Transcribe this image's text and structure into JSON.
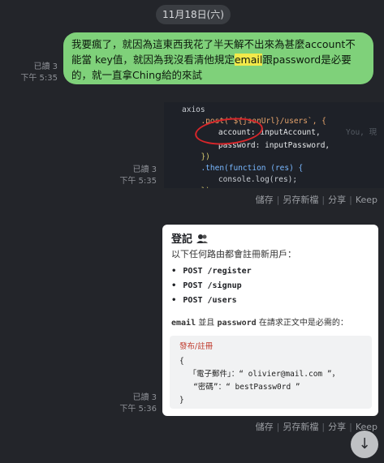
{
  "date_pill": "11月18日(六)",
  "messages": {
    "m1": {
      "text_before": "我要瘋了，就因為這東西我花了半天解不出來為甚麼account不能當 key值，就因為我沒看清他規定",
      "highlight": "email",
      "text_after": "跟password是必要的，就一直拿Ching給的來試",
      "read": "已讀 3",
      "time": "下午 5:35"
    },
    "m2": {
      "read": "已讀 3",
      "time": "下午 5:35",
      "code_lines": [
        "axios",
        "  .post(`${jsonUrl}/users`, {",
        "    account: inputAccount,",
        "    password: inputPassword,",
        "  })",
        "  .then(function (res) {",
        "    console.log(res);",
        "  })"
      ],
      "ghost": "You, 現"
    },
    "m3": {
      "read": "已讀 3",
      "time": "下午 5:36",
      "title": "登記",
      "intro": "以下任何路由都會註冊新用戶：",
      "routes": [
        "POST /register",
        "POST /signup",
        "POST /users"
      ],
      "note_email": "email",
      "note_mid": " 並且 ",
      "note_password": "password",
      "note_end": " 在請求正文中是必需的：",
      "code_label": "發布/註冊",
      "code_open": "{",
      "code_line1": "  「電子郵件」：“ olivier@mail.com ”，",
      "code_line2": "   “密碼”：“ bestPassw0rd ”",
      "code_close": "}"
    }
  },
  "actions": {
    "save": "儲存",
    "save_as": "另存新檔",
    "share": "分享",
    "keep": "Keep"
  },
  "colors": {
    "background": "#23252a",
    "own_bubble": "#7fd17a",
    "highlight": "#f2e94a",
    "annotation": "#d8262a"
  },
  "icons": {
    "scroll_down": "↓"
  }
}
